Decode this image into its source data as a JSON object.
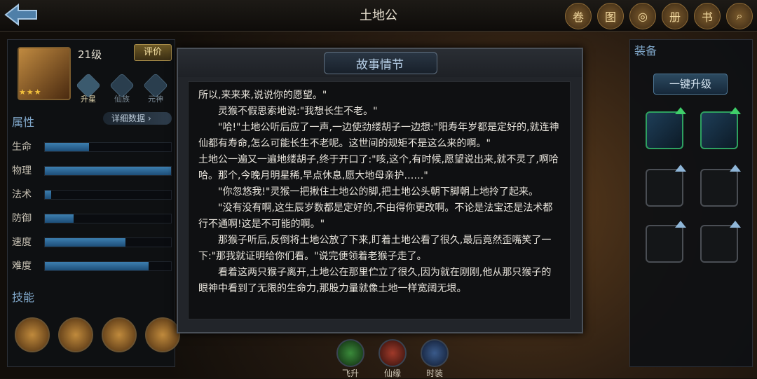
{
  "header": {
    "title": "土地公"
  },
  "top_icons": [
    "scroll-icon",
    "map-icon",
    "coin-icon",
    "book-icon",
    "manual-icon",
    "search-icon"
  ],
  "hero": {
    "level": "21级",
    "eval_label": "评价",
    "stars": "★★★"
  },
  "ranks": [
    {
      "label": "升星",
      "active": true
    },
    {
      "label": "仙族",
      "active": false
    },
    {
      "label": "元神",
      "active": false
    }
  ],
  "attributes": {
    "title": "属性",
    "detail_label": "详细数据",
    "stats": [
      {
        "label": "生命",
        "fill": 0.35
      },
      {
        "label": "物理",
        "fill": 1.0
      },
      {
        "label": "法术",
        "fill": 0.05
      },
      {
        "label": "防御",
        "fill": 0.23
      },
      {
        "label": "速度",
        "fill": 0.64
      },
      {
        "label": "难度",
        "fill": 0.82
      }
    ]
  },
  "skills": {
    "title": "技能"
  },
  "equipment": {
    "title": "装备",
    "upgrade_label": "一键升级"
  },
  "bottom": [
    {
      "label": "飞升",
      "color": "#3a8a3a"
    },
    {
      "label": "仙缘",
      "color": "#a03a2a"
    },
    {
      "label": "时装",
      "color": "#3a5a8a"
    }
  ],
  "story": {
    "title": "故事情节",
    "paragraphs": [
      "所以,来来来,说说你的愿望。\"",
      "灵猴不假思索地说:\"我想长生不老。\"",
      "\"哈!\"土地公听后应了一声,一边使劲缕胡子一边想:\"阳寿年岁都是定好的,就连神仙都有寿命,怎么可能长生不老呢。这世间的规矩不是这么来的啊。\"",
      "土地公一遍又一遍地缕胡子,终于开口了:\"咳,这个,有时候,愿望说出来,就不灵了,啊哈哈。那个,今晚月明星稀,早点休息,愿大地母亲护……\"",
      "\"你忽悠我!\"灵猴一把揪住土地公的脚,把土地公头朝下脚朝上地拎了起来。",
      "\"没有没有啊,这生辰岁数都是定好的,不由得你更改啊。不论是法宝还是法术都行不通啊!这是不可能的啊。\"",
      "那猴子听后,反倒将土地公放了下来,盯着土地公看了很久,最后竟然歪嘴笑了一下:\"那我就证明给你们看。\"说完便领着老猴子走了。",
      "看着这两只猴子离开,土地公在那里伫立了很久,因为就在刚刚,他从那只猴子的眼神中看到了无限的生命力,那股力量就像土地一样宽阔无垠。"
    ]
  }
}
